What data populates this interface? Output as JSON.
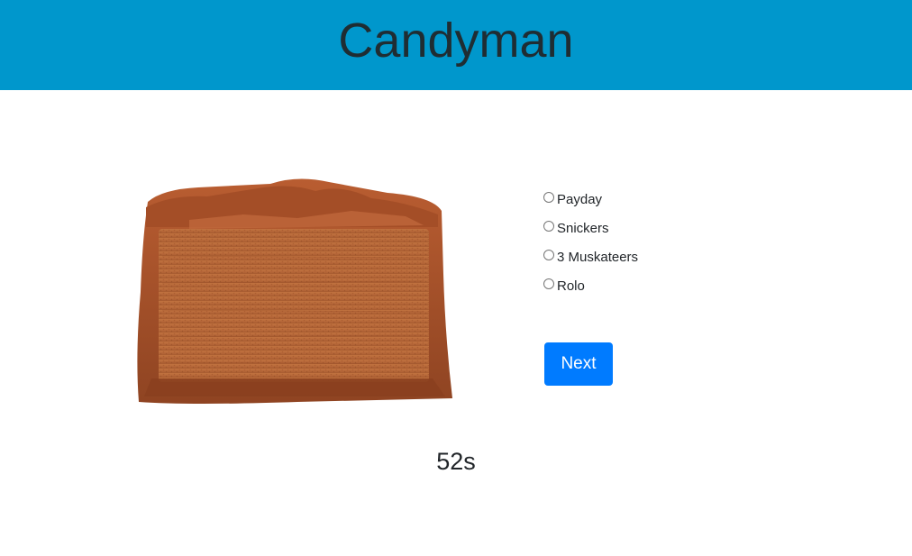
{
  "header": {
    "title": "Candyman",
    "background_color": "#0097cc"
  },
  "quiz": {
    "image_subject": "cross-section of chocolate candy bar",
    "options": [
      {
        "label": "Payday",
        "selected": false
      },
      {
        "label": "Snickers",
        "selected": false
      },
      {
        "label": "3 Muskateers",
        "selected": false
      },
      {
        "label": "Rolo",
        "selected": false
      }
    ],
    "next_label": "Next",
    "button_color": "#007bff"
  },
  "timer": {
    "value": "52s"
  }
}
